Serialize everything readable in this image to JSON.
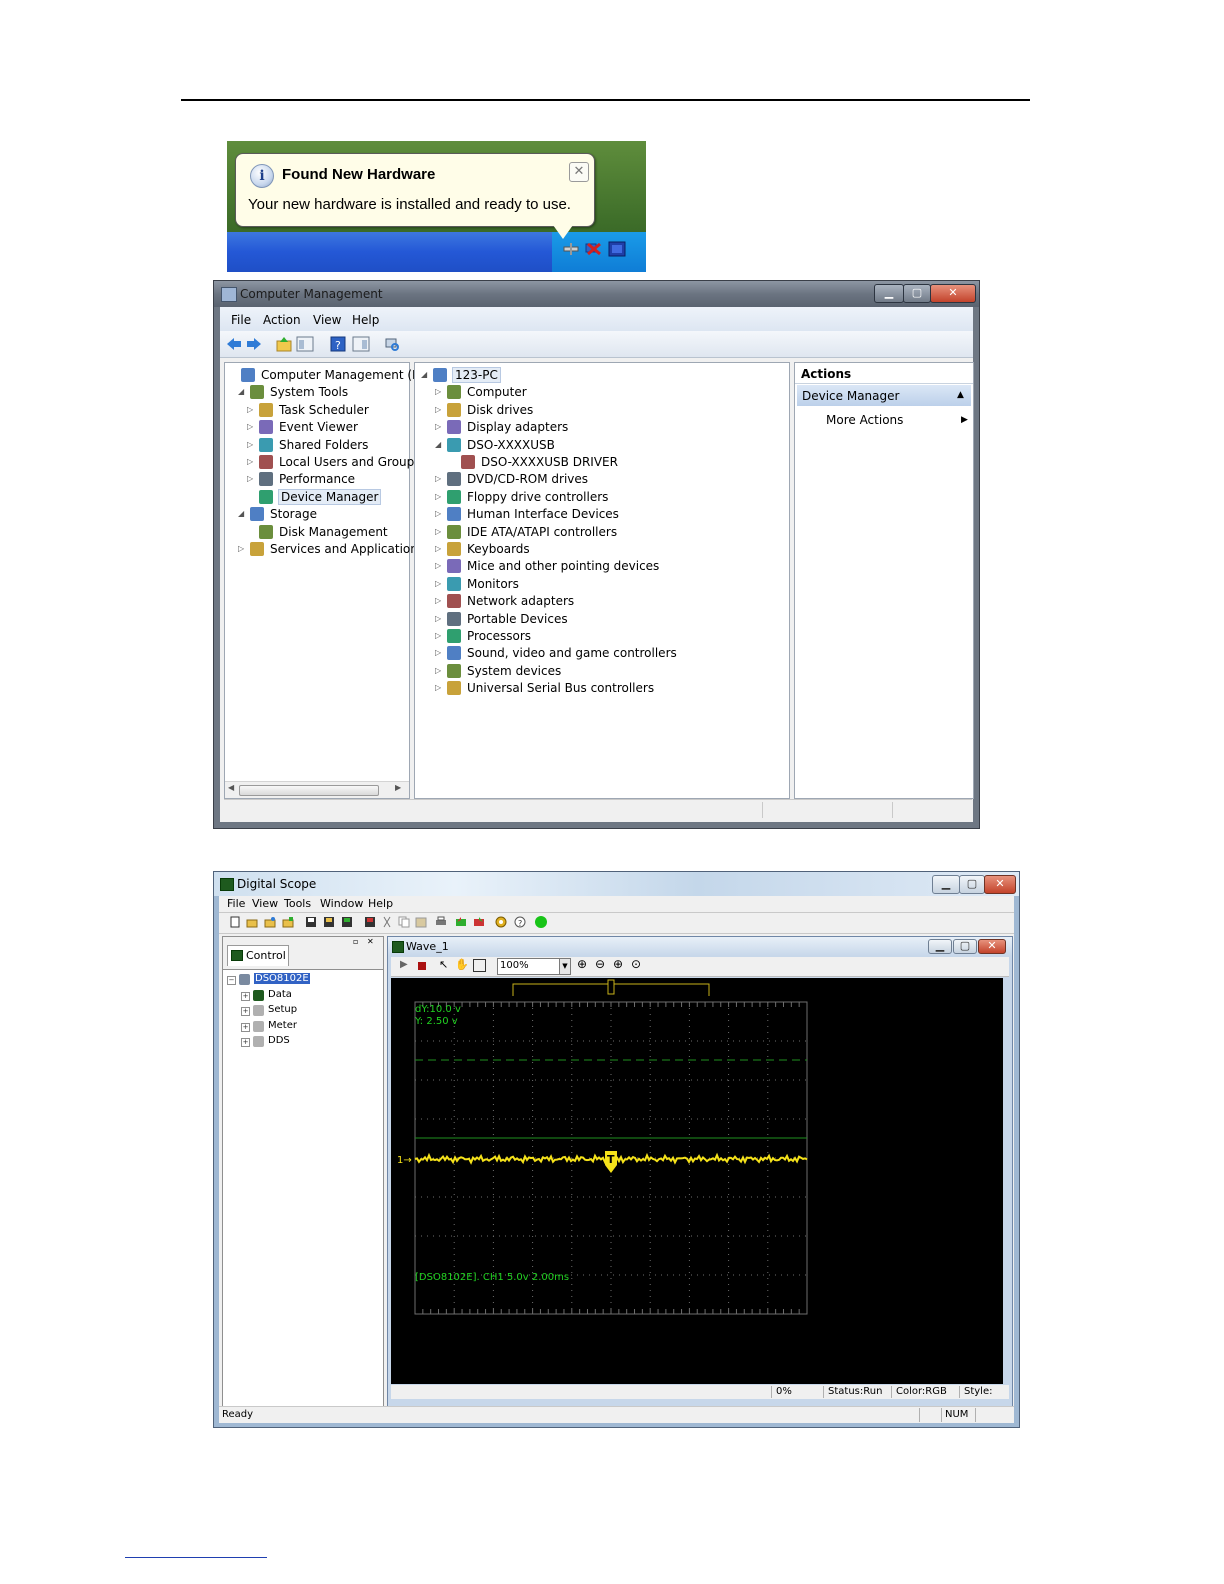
{
  "balloon": {
    "title": "Found New Hardware",
    "message": "Your new hardware is installed and ready to use.",
    "close_glyph": "✕"
  },
  "computer_management": {
    "window_title": "Computer Management",
    "menu": [
      "File",
      "Action",
      "View",
      "Help"
    ],
    "left_tree": [
      {
        "label": "Computer Management (Local",
        "icon": "computer-management-icon",
        "expander": "",
        "level": 0
      },
      {
        "label": "System Tools",
        "icon": "tools-icon",
        "expander": "◢",
        "level": 1
      },
      {
        "label": "Task Scheduler",
        "icon": "clock-icon",
        "expander": "▷",
        "level": 2
      },
      {
        "label": "Event Viewer",
        "icon": "event-viewer-icon",
        "expander": "▷",
        "level": 2
      },
      {
        "label": "Shared Folders",
        "icon": "shared-folder-icon",
        "expander": "▷",
        "level": 2
      },
      {
        "label": "Local Users and Groups",
        "icon": "users-icon",
        "expander": "▷",
        "level": 2
      },
      {
        "label": "Performance",
        "icon": "performance-icon",
        "expander": "▷",
        "level": 2
      },
      {
        "label": "Device Manager",
        "icon": "device-manager-icon",
        "expander": "",
        "level": 2,
        "selected": true
      },
      {
        "label": "Storage",
        "icon": "storage-icon",
        "expander": "◢",
        "level": 1
      },
      {
        "label": "Disk Management",
        "icon": "disk-icon",
        "expander": "",
        "level": 2
      },
      {
        "label": "Services and Applications",
        "icon": "services-icon",
        "expander": "▷",
        "level": 1
      }
    ],
    "device_tree": [
      {
        "label": "123-PC",
        "icon": "pc-icon",
        "expander": "◢",
        "level": 0,
        "highlight": true
      },
      {
        "label": "Computer",
        "icon": "computer-icon",
        "expander": "▷",
        "level": 1
      },
      {
        "label": "Disk drives",
        "icon": "disk-drive-icon",
        "expander": "▷",
        "level": 1
      },
      {
        "label": "Display adapters",
        "icon": "display-adapter-icon",
        "expander": "▷",
        "level": 1
      },
      {
        "label": "DSO-XXXXUSB",
        "icon": "usb-device-icon",
        "expander": "◢",
        "level": 1
      },
      {
        "label": "DSO-XXXXUSB DRIVER",
        "icon": "usb-device-icon",
        "expander": "",
        "level": 2
      },
      {
        "label": "DVD/CD-ROM drives",
        "icon": "dvd-icon",
        "expander": "▷",
        "level": 1
      },
      {
        "label": "Floppy drive controllers",
        "icon": "floppy-icon",
        "expander": "▷",
        "level": 1
      },
      {
        "label": "Human Interface Devices",
        "icon": "hid-icon",
        "expander": "▷",
        "level": 1
      },
      {
        "label": "IDE ATA/ATAPI controllers",
        "icon": "ide-icon",
        "expander": "▷",
        "level": 1
      },
      {
        "label": "Keyboards",
        "icon": "keyboard-icon",
        "expander": "▷",
        "level": 1
      },
      {
        "label": "Mice and other pointing devices",
        "icon": "mouse-icon",
        "expander": "▷",
        "level": 1
      },
      {
        "label": "Monitors",
        "icon": "monitor-icon",
        "expander": "▷",
        "level": 1
      },
      {
        "label": "Network adapters",
        "icon": "network-icon",
        "expander": "▷",
        "level": 1
      },
      {
        "label": "Portable Devices",
        "icon": "portable-device-icon",
        "expander": "▷",
        "level": 1
      },
      {
        "label": "Processors",
        "icon": "processor-icon",
        "expander": "▷",
        "level": 1
      },
      {
        "label": "Sound, video and game controllers",
        "icon": "sound-icon",
        "expander": "▷",
        "level": 1
      },
      {
        "label": "System devices",
        "icon": "system-device-icon",
        "expander": "▷",
        "level": 1
      },
      {
        "label": "Universal Serial Bus controllers",
        "icon": "usb-icon",
        "expander": "▷",
        "level": 1
      }
    ],
    "actions": {
      "title": "Actions",
      "section": "Device Manager",
      "more": "More Actions"
    }
  },
  "digital_scope": {
    "window_title": "Digital Scope",
    "menu": [
      "File",
      "View",
      "Tools",
      "Window",
      "Help"
    ],
    "control_tab": "Control",
    "control_tree": [
      {
        "label": "DSO8102E",
        "icon": "device-icon",
        "selected": true,
        "level": 0
      },
      {
        "label": "Data",
        "icon": "data-icon",
        "level": 1
      },
      {
        "label": "Setup",
        "icon": "setup-icon",
        "level": 1
      },
      {
        "label": "Meter",
        "icon": "meter-icon",
        "level": 1
      },
      {
        "label": "DDS",
        "icon": "dds-icon",
        "level": 1
      }
    ],
    "wave_window_title": "Wave_1",
    "zoom": "100%",
    "scope": {
      "readout_dy": "dY:10.0 v",
      "readout_y": "Y:  2.50 v",
      "channel_info": "[DSO8102E]. CH1 5.0v 2.00ms",
      "channel_marker": "1",
      "trigger_marker": "T",
      "trace_color": "#f5e21a",
      "grid_color": "#6e6e6e",
      "text_color": "#21d021"
    },
    "wave_status": {
      "percent": "0%",
      "status": "Status:Run",
      "color": "Color:RGB",
      "style": "Style:"
    },
    "statusbar": {
      "ready": "Ready",
      "num": "NUM"
    }
  }
}
